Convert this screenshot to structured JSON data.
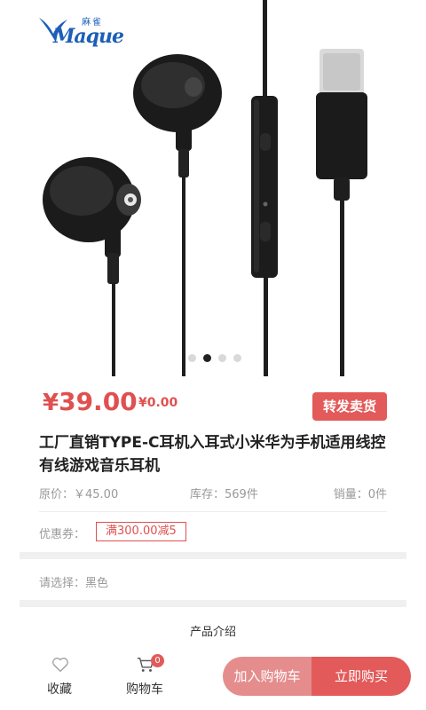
{
  "brand": {
    "logo_text": "Maque",
    "logo_cn": "麻雀",
    "accent": "#1c5fb8"
  },
  "gallery": {
    "slides": 4,
    "active_index": 1
  },
  "price": {
    "current_symbol": "¥",
    "current": "39.00",
    "original_tag": "¥0.00",
    "color": "#e05050"
  },
  "resell_button": "转发卖货",
  "product": {
    "title": "工厂直销TYPE-C耳机入耳式小米华为手机适用线控有线游戏音乐耳机",
    "original_price": "原价：￥45.00",
    "stock": "库存：569件",
    "sales": "销量：0件"
  },
  "coupon": {
    "label": "优惠券：",
    "tag": "满300.00减5"
  },
  "spec": {
    "select_text": "请选择：黑色"
  },
  "section": {
    "intro_title": "产品介绍"
  },
  "bottom_bar": {
    "favorite_label": "收藏",
    "cart_label": "购物车",
    "cart_count": "0",
    "add_to_cart": "加入购物车",
    "buy_now": "立即购买"
  }
}
